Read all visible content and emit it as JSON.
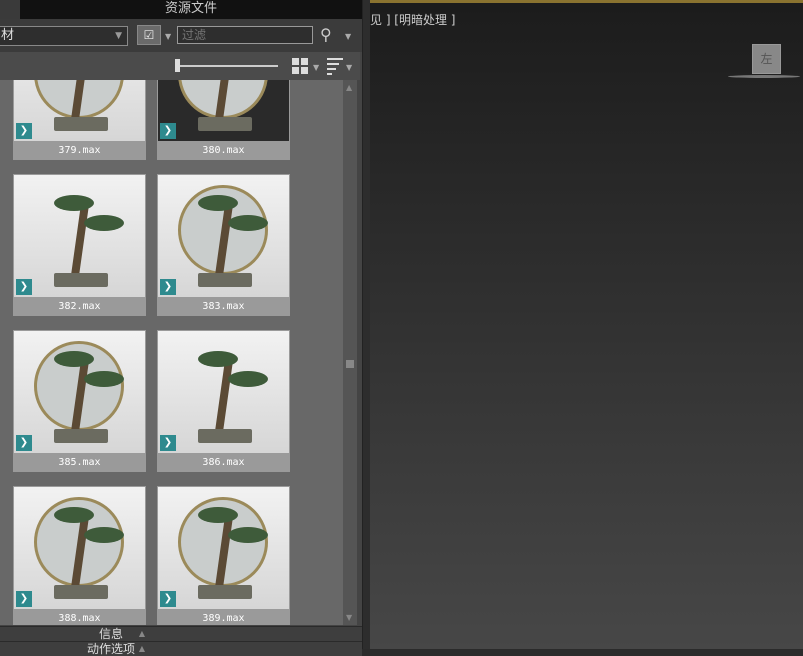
{
  "panel": {
    "title": "资源文件",
    "combo_value": "材",
    "filter_placeholder": "过滤",
    "sections": [
      "信息",
      "动作选项"
    ]
  },
  "items": [
    {
      "label": "379.max"
    },
    {
      "label": "380.max"
    },
    {
      "label": "382.max"
    },
    {
      "label": "383.max"
    },
    {
      "label": "385.max"
    },
    {
      "label": "386.max"
    },
    {
      "label": "388.max"
    },
    {
      "label": "389.max"
    }
  ],
  "viewport": {
    "label": "见 ] [明暗处理 ]",
    "viewcube_face": "左"
  },
  "colors": {
    "accent": "#8a7330",
    "badge": "#2e8a8e"
  }
}
